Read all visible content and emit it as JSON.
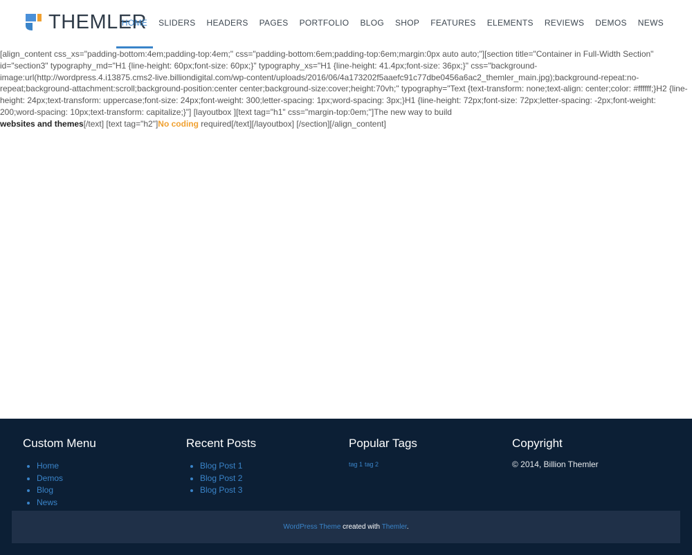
{
  "brand": {
    "name": "THEMLER",
    "colors": {
      "accent": "#3a84c9",
      "orange": "#f0a030",
      "footer_bg": "#0c1f35",
      "footer_bar": "#1f3048"
    }
  },
  "nav": {
    "items": [
      "HOME",
      "SLIDERS",
      "HEADERS",
      "PAGES",
      "PORTFOLIO",
      "BLOG",
      "SHOP",
      "FEATURES",
      "ELEMENTS",
      "REVIEWS",
      "DEMOS",
      "NEWS"
    ],
    "active": "HOME"
  },
  "content": {
    "line1": "[align_content css_xs=\"padding-bottom:4em;padding-top:4em;\" css=\"padding-bottom:6em;padding-top:6em;margin:0px auto auto;\"][section title=\"Container in Full-Width Section\" id=\"section3\" typography_md=\"H1 {line-height: 60px;font-size: 60px;}\" typography_xs=\"H1 {line-height: 41.4px;font-size: 36px;}\" css=\"background-image:url(http://wordpress.4.i13875.cms2-live.billiondigital.com/wp-content/uploads/2016/06/4a173202f5aaefc91c77dbe0456a6ac2_themler_main.jpg);background-repeat:no-repeat;background-attachment:scroll;background-position:center center;background-size:cover;height:70vh;\" typography=\"Text {text-transform: none;text-align: center;color: #ffffff;}H2 {line-height: 24px;text-transform: uppercase;font-size: 24px;font-weight: 300;letter-spacing: 1px;word-spacing: 3px;}H1 {line-height: 72px;font-size: 72px;letter-spacing: -2px;font-weight: 200;word-spacing: 10px;text-transform: capitalize;}\"] [layoutbox ][text tag=\"h1\" css=\"margin-top:0em;\"]The new way to build",
    "bold_dark": "websites and themes",
    "mid": "[/text] [text tag=\"h2\"]",
    "bold_orange": "No coding",
    "tail": " required[/text][/layoutbox] [/section][/align_content]"
  },
  "footer": {
    "custom_menu": {
      "title": "Custom Menu",
      "items": [
        "Home",
        "Demos",
        "Blog",
        "News"
      ]
    },
    "recent_posts": {
      "title": "Recent Posts",
      "items": [
        "Blog Post 1",
        "Blog Post 2",
        "Blog Post 3"
      ]
    },
    "popular_tags": {
      "title": "Popular Tags",
      "tags": [
        "tag 1",
        "tag 2"
      ]
    },
    "copyright": {
      "title": "Copyright",
      "text": "© 2014, Billion Themler"
    },
    "bottom": {
      "link1": "WordPress Theme",
      "middle": " created with ",
      "link2": "Themler",
      "end": "."
    }
  }
}
